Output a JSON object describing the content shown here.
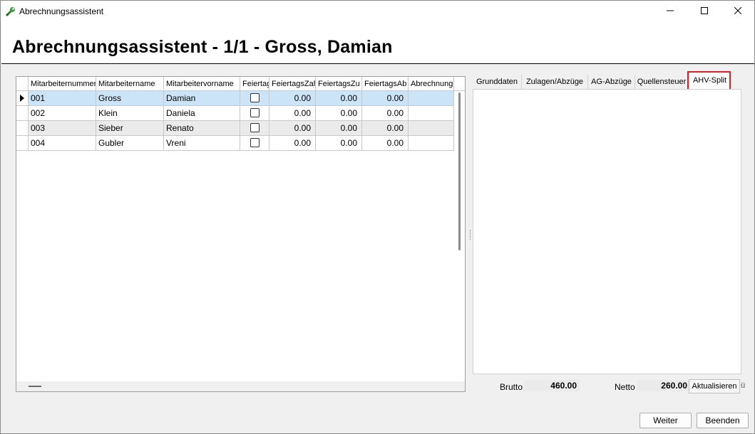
{
  "window": {
    "title": "Abrechnungsassistent",
    "app_icon": "green-wrench-icon",
    "controls": {
      "minimize": "minimize-icon",
      "maximize": "maximize-icon",
      "close": "close-icon"
    }
  },
  "header": {
    "title": "Abrechnungsassistent - 1/1 - Gross, Damian"
  },
  "grid": {
    "columns": [
      "Mitarbeiternummer",
      "Mitarbeitername",
      "Mitarbeitervorname",
      "Feiertag",
      "FeiertagsZah",
      "FeiertagsZu",
      "FeiertagsAb",
      "Abrechnungs"
    ],
    "rows": [
      {
        "nummer": "001",
        "name": "Gross",
        "vorname": "Damian",
        "feiertag": false,
        "zah": "0.00",
        "zu": "0.00",
        "ab": "0.00",
        "abrechnung": ""
      },
      {
        "nummer": "002",
        "name": "Klein",
        "vorname": "Daniela",
        "feiertag": false,
        "zah": "0.00",
        "zu": "0.00",
        "ab": "0.00",
        "abrechnung": ""
      },
      {
        "nummer": "003",
        "name": "Sieber",
        "vorname": "Renato",
        "feiertag": false,
        "zah": "0.00",
        "zu": "0.00",
        "ab": "0.00",
        "abrechnung": ""
      },
      {
        "nummer": "004",
        "name": "Gubler",
        "vorname": "Vreni",
        "feiertag": false,
        "zah": "0.00",
        "zu": "0.00",
        "ab": "0.00",
        "abrechnung": ""
      }
    ],
    "selected_row": 0
  },
  "tabs": {
    "items": [
      "Grunddaten",
      "Zulagen/Abzüge",
      "AG-Abzüge",
      "Quellensteuer",
      "AHV-Split"
    ],
    "active": "AHV-Split"
  },
  "summary": {
    "brutto_label": "Brutto",
    "brutto_value": "460.00",
    "netto_label": "Netto",
    "netto_value": "260.00",
    "refresh_label": "Aktualisieren",
    "trailing": "ü"
  },
  "footer": {
    "next_label": "Weiter",
    "finish_label": "Beenden"
  },
  "colors": {
    "selection": "#cce4f7",
    "alt_row": "#ebebeb",
    "highlight": "#d2232a"
  }
}
